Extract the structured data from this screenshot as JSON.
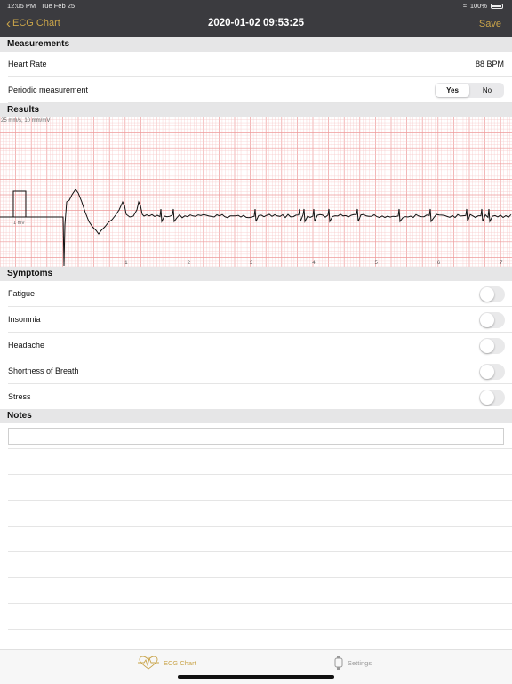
{
  "status_bar": {
    "time": "12:05 PM",
    "date": "Tue Feb 25",
    "battery": "100%"
  },
  "nav": {
    "back_label": "ECG Chart",
    "title": "2020-01-02 09:53:25",
    "save_label": "Save"
  },
  "measurements": {
    "header": "Measurements",
    "heart_rate_label": "Heart Rate",
    "heart_rate_value": "88 BPM",
    "periodic_label": "Periodic measurement",
    "periodic_options": [
      "Yes",
      "No"
    ],
    "periodic_selected": "Yes"
  },
  "results": {
    "header": "Results",
    "scale_label": "25 mm/s, 10 mm/mV",
    "calibration_label": "1 mV",
    "seconds_ticks": [
      "1",
      "2",
      "3",
      "4",
      "5",
      "6",
      "7"
    ]
  },
  "symptoms": {
    "header": "Symptoms",
    "items": [
      {
        "label": "Fatigue",
        "on": false
      },
      {
        "label": "Insomnia",
        "on": false
      },
      {
        "label": "Headache",
        "on": false
      },
      {
        "label": "Shortness of Breath",
        "on": false
      },
      {
        "label": "Stress",
        "on": false
      }
    ]
  },
  "notes": {
    "header": "Notes",
    "value": ""
  },
  "tabs": [
    {
      "label": "ECG Chart",
      "icon": "heart-ecg-icon",
      "selected": true
    },
    {
      "label": "Settings",
      "icon": "watch-icon",
      "selected": false
    }
  ],
  "colors": {
    "accent": "#c9a44a",
    "grid_minor": "#f6c9c9",
    "grid_major": "#ee9a9a",
    "trace": "#111111"
  }
}
